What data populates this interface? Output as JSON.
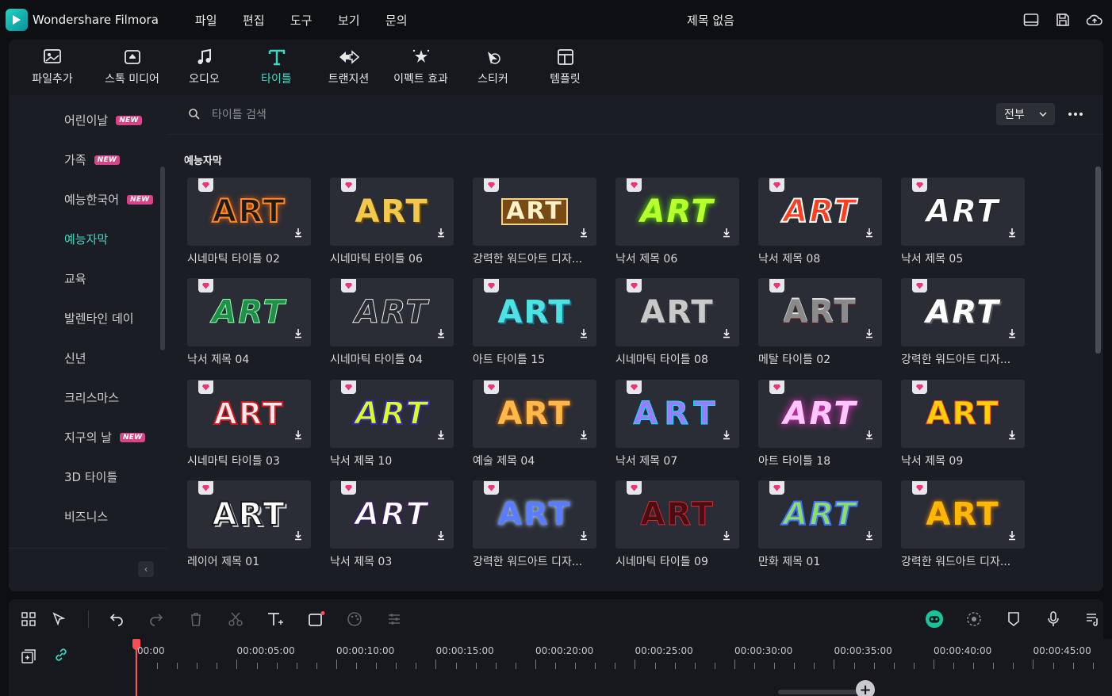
{
  "app": {
    "name": "Wondershare Filmora",
    "window_title": "제목 없음"
  },
  "menu": [
    "파일",
    "편집",
    "도구",
    "보기",
    "문의"
  ],
  "toolbar": [
    {
      "label": "파일추가",
      "icon": "import-media-icon",
      "active": false
    },
    {
      "label": "스톡 미디어",
      "icon": "stock-media-icon",
      "active": false
    },
    {
      "label": "오디오",
      "icon": "audio-note-icon",
      "active": false
    },
    {
      "label": "타이틀",
      "icon": "title-t-icon",
      "active": true
    },
    {
      "label": "트랜지션",
      "icon": "transition-icon",
      "active": false
    },
    {
      "label": "이펙트 효과",
      "icon": "effects-icon",
      "active": false
    },
    {
      "label": "스티커",
      "icon": "sticker-icon",
      "active": false
    },
    {
      "label": "템플릿",
      "icon": "template-icon",
      "active": false
    }
  ],
  "sidebar": {
    "categories": [
      {
        "label": "어린이날",
        "new": true,
        "active": false
      },
      {
        "label": "가족",
        "new": true,
        "active": false
      },
      {
        "label": "예능한국어",
        "new": true,
        "active": false
      },
      {
        "label": "예능자막",
        "new": false,
        "active": true
      },
      {
        "label": "교육",
        "new": false,
        "active": false
      },
      {
        "label": "발렌타인 데이",
        "new": false,
        "active": false
      },
      {
        "label": "신년",
        "new": false,
        "active": false
      },
      {
        "label": "크리스마스",
        "new": false,
        "active": false
      },
      {
        "label": "지구의 날",
        "new": true,
        "active": false
      },
      {
        "label": "3D 타이틀",
        "new": false,
        "active": false
      },
      {
        "label": "비즈니스",
        "new": false,
        "active": false
      }
    ],
    "new_badge": "NEW",
    "collapse_glyph": "‹"
  },
  "search": {
    "placeholder": "타이틀 검색",
    "filter_value": "전부"
  },
  "section_title": "예능자막",
  "items": [
    {
      "label": "시네마틱 타이틀 02"
    },
    {
      "label": "시네마틱 타이틀 06"
    },
    {
      "label": "강력한 워드아트 디자..."
    },
    {
      "label": "낙서 제목 06"
    },
    {
      "label": "낙서 제목 08"
    },
    {
      "label": "낙서 제목 05"
    },
    {
      "label": "낙서 제목 04"
    },
    {
      "label": "시네마틱 타이틀 04"
    },
    {
      "label": "아트 타이틀 15"
    },
    {
      "label": "시네마틱 타이틀 08"
    },
    {
      "label": "메탈 타이틀 02"
    },
    {
      "label": "강력한 워드아트 디자..."
    },
    {
      "label": "시네마틱 타이틀 03"
    },
    {
      "label": "낙서 제목 10"
    },
    {
      "label": "예술 제목 04"
    },
    {
      "label": "낙서 제목 07"
    },
    {
      "label": "아트 타이틀 18"
    },
    {
      "label": "낙서 제목 09"
    },
    {
      "label": "레이어 제목 01"
    },
    {
      "label": "낙서 제목 03"
    },
    {
      "label": "강력한 워드아트 디자..."
    },
    {
      "label": "시네마틱 타이틀 09"
    },
    {
      "label": "만화 제목 01"
    },
    {
      "label": "강력한 워드아트 디자..."
    }
  ],
  "thumb_text": "ART",
  "timeline": {
    "ticks": [
      "00:00",
      "00:00:05:00",
      "00:00:10:00",
      "00:00:15:00",
      "00:00:20:00",
      "00:00:25:00",
      "00:00:30:00",
      "00:00:35:00",
      "00:00:40:00",
      "00:00:45:00"
    ],
    "zoom_glyph": "+"
  },
  "colors": {
    "accent": "#3fd9c7",
    "new_badge": "#d6448a",
    "playhead": "#ff4d56",
    "background": "#0e0f13",
    "panel": "#1b1d24"
  }
}
